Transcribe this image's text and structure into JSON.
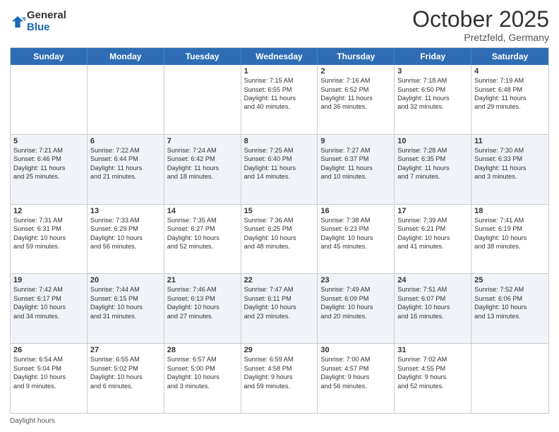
{
  "logo": {
    "general": "General",
    "blue": "Blue"
  },
  "title": "October 2025",
  "location": "Pretzfeld, Germany",
  "days_of_week": [
    "Sunday",
    "Monday",
    "Tuesday",
    "Wednesday",
    "Thursday",
    "Friday",
    "Saturday"
  ],
  "footer": "Daylight hours",
  "weeks": [
    {
      "alt": false,
      "cells": [
        {
          "day": "",
          "text": ""
        },
        {
          "day": "",
          "text": ""
        },
        {
          "day": "",
          "text": ""
        },
        {
          "day": "1",
          "text": "Sunrise: 7:15 AM\nSunset: 6:55 PM\nDaylight: 11 hours\nand 40 minutes."
        },
        {
          "day": "2",
          "text": "Sunrise: 7:16 AM\nSunset: 6:52 PM\nDaylight: 11 hours\nand 36 minutes."
        },
        {
          "day": "3",
          "text": "Sunrise: 7:18 AM\nSunset: 6:50 PM\nDaylight: 11 hours\nand 32 minutes."
        },
        {
          "day": "4",
          "text": "Sunrise: 7:19 AM\nSunset: 6:48 PM\nDaylight: 11 hours\nand 29 minutes."
        }
      ]
    },
    {
      "alt": true,
      "cells": [
        {
          "day": "5",
          "text": "Sunrise: 7:21 AM\nSunset: 6:46 PM\nDaylight: 11 hours\nand 25 minutes."
        },
        {
          "day": "6",
          "text": "Sunrise: 7:22 AM\nSunset: 6:44 PM\nDaylight: 11 hours\nand 21 minutes."
        },
        {
          "day": "7",
          "text": "Sunrise: 7:24 AM\nSunset: 6:42 PM\nDaylight: 11 hours\nand 18 minutes."
        },
        {
          "day": "8",
          "text": "Sunrise: 7:25 AM\nSunset: 6:40 PM\nDaylight: 11 hours\nand 14 minutes."
        },
        {
          "day": "9",
          "text": "Sunrise: 7:27 AM\nSunset: 6:37 PM\nDaylight: 11 hours\nand 10 minutes."
        },
        {
          "day": "10",
          "text": "Sunrise: 7:28 AM\nSunset: 6:35 PM\nDaylight: 11 hours\nand 7 minutes."
        },
        {
          "day": "11",
          "text": "Sunrise: 7:30 AM\nSunset: 6:33 PM\nDaylight: 11 hours\nand 3 minutes."
        }
      ]
    },
    {
      "alt": false,
      "cells": [
        {
          "day": "12",
          "text": "Sunrise: 7:31 AM\nSunset: 6:31 PM\nDaylight: 10 hours\nand 59 minutes."
        },
        {
          "day": "13",
          "text": "Sunrise: 7:33 AM\nSunset: 6:29 PM\nDaylight: 10 hours\nand 56 minutes."
        },
        {
          "day": "14",
          "text": "Sunrise: 7:35 AM\nSunset: 6:27 PM\nDaylight: 10 hours\nand 52 minutes."
        },
        {
          "day": "15",
          "text": "Sunrise: 7:36 AM\nSunset: 6:25 PM\nDaylight: 10 hours\nand 48 minutes."
        },
        {
          "day": "16",
          "text": "Sunrise: 7:38 AM\nSunset: 6:23 PM\nDaylight: 10 hours\nand 45 minutes."
        },
        {
          "day": "17",
          "text": "Sunrise: 7:39 AM\nSunset: 6:21 PM\nDaylight: 10 hours\nand 41 minutes."
        },
        {
          "day": "18",
          "text": "Sunrise: 7:41 AM\nSunset: 6:19 PM\nDaylight: 10 hours\nand 38 minutes."
        }
      ]
    },
    {
      "alt": true,
      "cells": [
        {
          "day": "19",
          "text": "Sunrise: 7:42 AM\nSunset: 6:17 PM\nDaylight: 10 hours\nand 34 minutes."
        },
        {
          "day": "20",
          "text": "Sunrise: 7:44 AM\nSunset: 6:15 PM\nDaylight: 10 hours\nand 31 minutes."
        },
        {
          "day": "21",
          "text": "Sunrise: 7:46 AM\nSunset: 6:13 PM\nDaylight: 10 hours\nand 27 minutes."
        },
        {
          "day": "22",
          "text": "Sunrise: 7:47 AM\nSunset: 6:11 PM\nDaylight: 10 hours\nand 23 minutes."
        },
        {
          "day": "23",
          "text": "Sunrise: 7:49 AM\nSunset: 6:09 PM\nDaylight: 10 hours\nand 20 minutes."
        },
        {
          "day": "24",
          "text": "Sunrise: 7:51 AM\nSunset: 6:07 PM\nDaylight: 10 hours\nand 16 minutes."
        },
        {
          "day": "25",
          "text": "Sunrise: 7:52 AM\nSunset: 6:06 PM\nDaylight: 10 hours\nand 13 minutes."
        }
      ]
    },
    {
      "alt": false,
      "cells": [
        {
          "day": "26",
          "text": "Sunrise: 6:54 AM\nSunset: 5:04 PM\nDaylight: 10 hours\nand 9 minutes."
        },
        {
          "day": "27",
          "text": "Sunrise: 6:55 AM\nSunset: 5:02 PM\nDaylight: 10 hours\nand 6 minutes."
        },
        {
          "day": "28",
          "text": "Sunrise: 6:57 AM\nSunset: 5:00 PM\nDaylight: 10 hours\nand 3 minutes."
        },
        {
          "day": "29",
          "text": "Sunrise: 6:59 AM\nSunset: 4:58 PM\nDaylight: 9 hours\nand 59 minutes."
        },
        {
          "day": "30",
          "text": "Sunrise: 7:00 AM\nSunset: 4:57 PM\nDaylight: 9 hours\nand 56 minutes."
        },
        {
          "day": "31",
          "text": "Sunrise: 7:02 AM\nSunset: 4:55 PM\nDaylight: 9 hours\nand 52 minutes."
        },
        {
          "day": "",
          "text": ""
        }
      ]
    }
  ]
}
